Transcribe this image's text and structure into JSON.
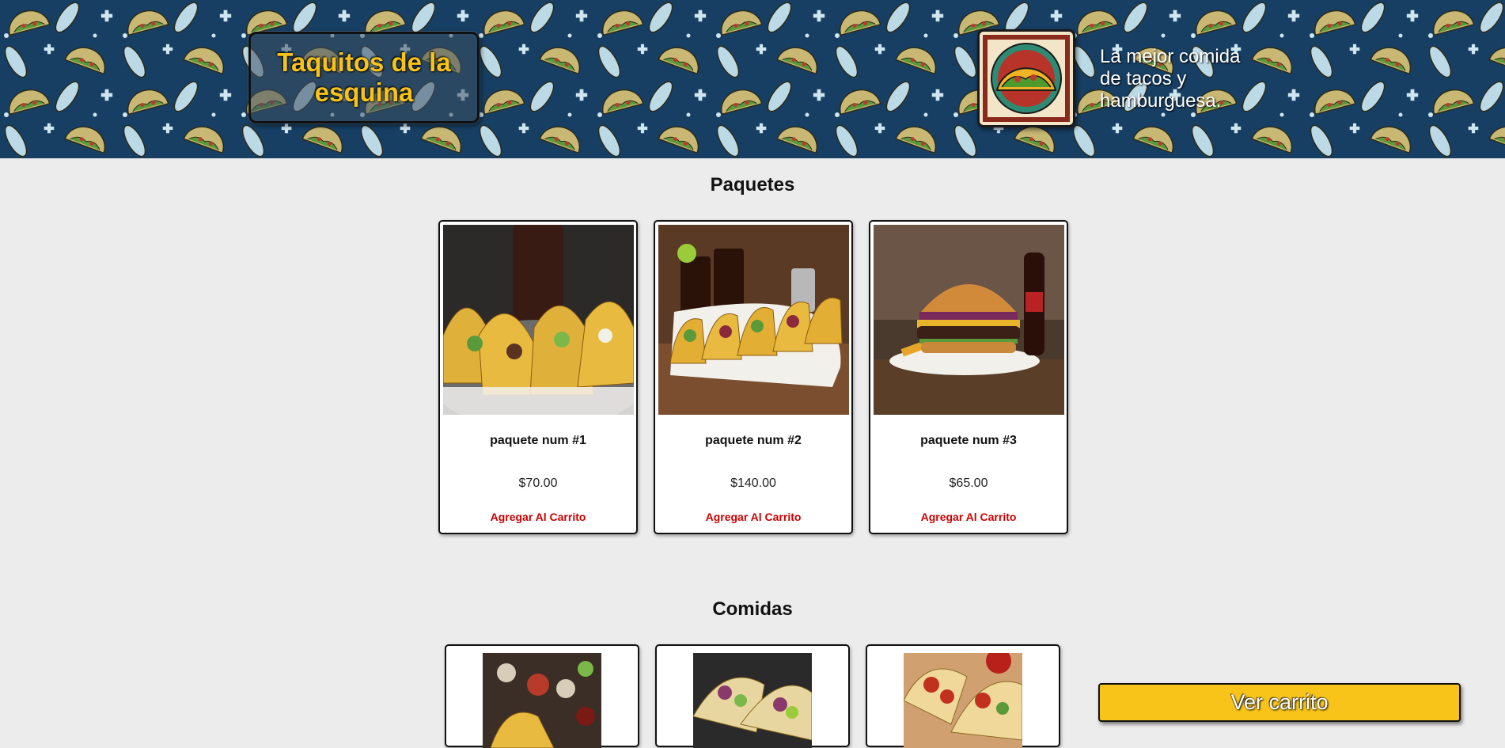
{
  "header": {
    "brand_title": "Taquitos de la esquina",
    "tagline": "La mejor comida de tacos y hamburguesa."
  },
  "sections": [
    {
      "title": "Paquetes",
      "items": [
        {
          "name": "paquete num #1",
          "price": "$70.00",
          "button": "Agregar Al Carrito",
          "image": "tacos-and-soda-photo"
        },
        {
          "name": "paquete num #2",
          "price": "$140.00",
          "button": "Agregar Al Carrito",
          "image": "tacos-and-drinks-photo"
        },
        {
          "name": "paquete num #3",
          "price": "$65.00",
          "button": "Agregar Al Carrito",
          "image": "burger-and-cola-photo"
        }
      ]
    },
    {
      "title": "Comidas",
      "items": [
        {
          "image": "tacos-with-salsas-photo"
        },
        {
          "image": "tacos-with-avocado-photo"
        },
        {
          "image": "red-tacos-photo"
        }
      ]
    }
  ],
  "cart": {
    "label": "Ver carrito"
  },
  "colors": {
    "banner_bg": "#173f63",
    "brand_text": "#f6c31b",
    "add_button_text": "#cc0000",
    "cart_button_bg": "#f8c419",
    "page_bg": "#ececec"
  }
}
